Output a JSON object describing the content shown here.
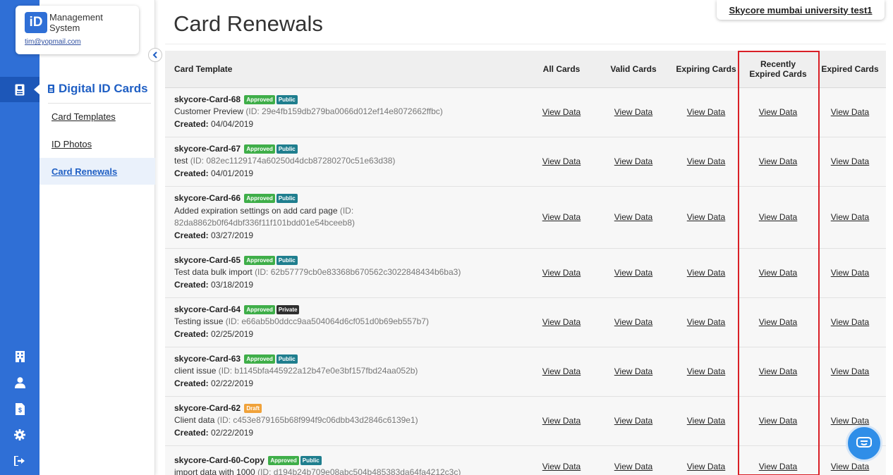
{
  "brand": {
    "logo_text": "iD",
    "name": "Management System",
    "email": "tim@yopmail.com"
  },
  "rail": {
    "items": [
      {
        "icon": "id-card-icon",
        "active": true
      },
      {
        "icon": "building-icon"
      },
      {
        "icon": "user-icon"
      },
      {
        "icon": "file-dollar-icon"
      },
      {
        "icon": "gear-icon"
      },
      {
        "icon": "logout-icon"
      }
    ]
  },
  "sidebar": {
    "title": "Digital ID Cards",
    "items": [
      {
        "label": "Card Templates"
      },
      {
        "label": "ID Photos"
      },
      {
        "label": "Card Renewals",
        "active": true
      }
    ]
  },
  "header": {
    "title": "Card Renewals",
    "org": "Skycore mumbai university test1"
  },
  "table": {
    "columns": [
      "Card Template",
      "All Cards",
      "Valid Cards",
      "Expiring Cards",
      "Recently Expired Cards",
      "Expired Cards"
    ],
    "link_label": "View Data",
    "rows": [
      {
        "name": "skycore-Card-68",
        "badges": [
          "Approved",
          "Public"
        ],
        "desc": "Customer Preview",
        "id": "(ID: 29e4fb159db279ba0066d012ef14e8072662ffbc)",
        "created_label": "Created:",
        "created": "04/04/2019"
      },
      {
        "name": "skycore-Card-67",
        "badges": [
          "Approved",
          "Public"
        ],
        "desc": "test",
        "id": "(ID: 082ec1129174a60250d4dcb87280270c51e63d38)",
        "created_label": "Created:",
        "created": "04/01/2019"
      },
      {
        "name": "skycore-Card-66",
        "badges": [
          "Approved",
          "Public"
        ],
        "desc": "Added expiration settings on add card page",
        "id": "(ID: 82da8862b0f64dbf336f11f101bdd01e54bceeb8)",
        "created_label": "Created:",
        "created": "03/27/2019"
      },
      {
        "name": "skycore-Card-65",
        "badges": [
          "Approved",
          "Public"
        ],
        "desc": "Test data bulk import",
        "id": "(ID: 62b57779cb0e83368b670562c3022848434b6ba3)",
        "created_label": "Created:",
        "created": "03/18/2019"
      },
      {
        "name": "skycore-Card-64",
        "badges": [
          "Approved",
          "Private"
        ],
        "desc": "Testing issue",
        "id": "(ID: e66ab5b0ddcc9aa504064d6cf051d0b69eb557b7)",
        "created_label": "Created:",
        "created": "02/25/2019"
      },
      {
        "name": "skycore-Card-63",
        "badges": [
          "Approved",
          "Public"
        ],
        "desc": "client issue",
        "id": "(ID: b1145bfa445922a12b47e0e3bf157fbd24aa052b)",
        "created_label": "Created:",
        "created": "02/22/2019"
      },
      {
        "name": "skycore-Card-62",
        "badges": [
          "Draft"
        ],
        "desc": "Client data",
        "id": "(ID: c453e879165b68f994f9c06dbb43d2846c6139e1)",
        "created_label": "Created:",
        "created": "02/22/2019"
      },
      {
        "name": "skycore-Card-60-Copy",
        "badges": [
          "Approved",
          "Public"
        ],
        "desc": "import data with 1000",
        "id": "(ID: d194b24b709e08abc504b485383da64fa4212c3c)",
        "created_label": "",
        "created": ""
      }
    ]
  },
  "colors": {
    "rail_blue": "#2f6fd6",
    "accent_blue": "#1f5fc4",
    "approved": "#3fae49",
    "public": "#1f7e8e",
    "private": "#2f2f2f",
    "draft": "#f0a23a",
    "highlight": "#d91f26"
  }
}
